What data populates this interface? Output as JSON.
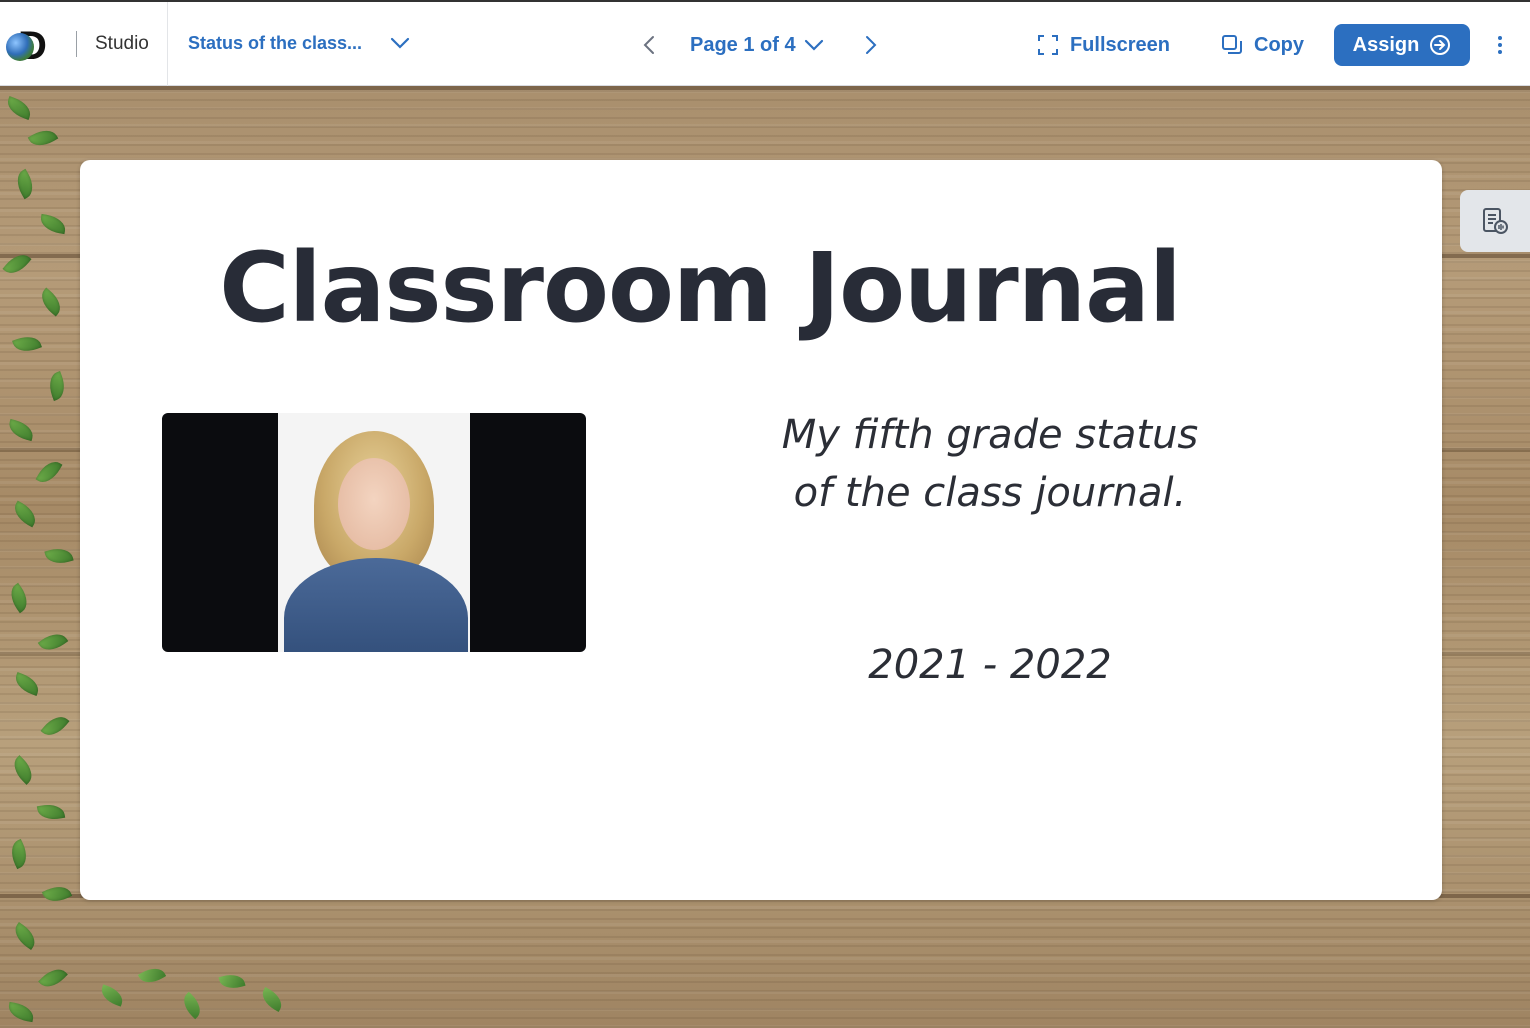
{
  "header": {
    "app_name": "Studio",
    "doc_title": "Status of the class...",
    "page_label": "Page 1 of 4",
    "fullscreen_label": "Fullscreen",
    "copy_label": "Copy",
    "assign_label": "Assign"
  },
  "slide": {
    "title": "Classroom Journal",
    "subtitle_line1": "My fifth grade status",
    "subtitle_line2": "of the class journal.",
    "years": "2021 - 2022"
  },
  "icons": {
    "logo": "discovery-globe-logo",
    "title_dropdown": "chevron-down-icon",
    "prev": "chevron-left-icon",
    "page_dropdown": "chevron-down-icon",
    "next": "chevron-right-icon",
    "fullscreen": "fullscreen-icon",
    "copy": "copy-icon",
    "assign": "arrow-circle-right-icon",
    "more": "kebab-menu-icon",
    "side_tab": "notes-audio-icon"
  },
  "colors": {
    "accent": "#2c6fc0",
    "text_dark": "#282c37"
  }
}
